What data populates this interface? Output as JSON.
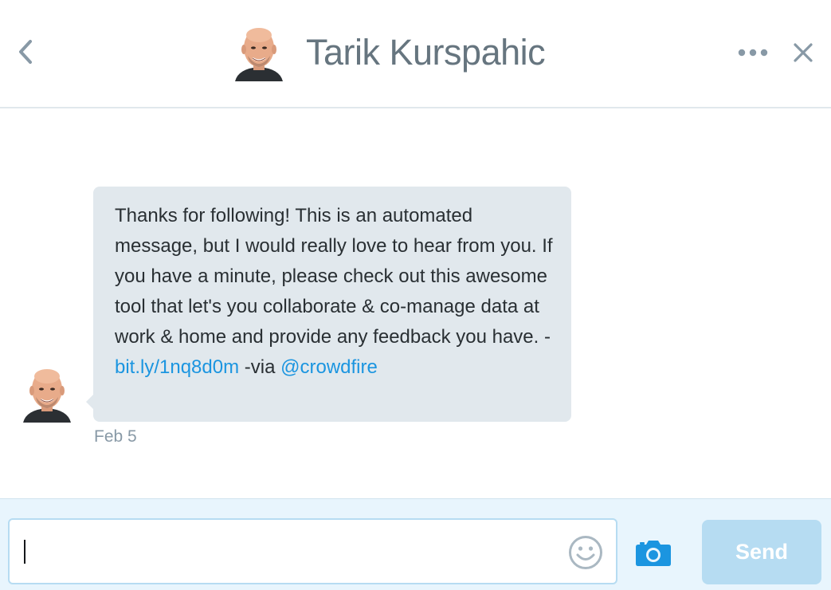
{
  "header": {
    "contact_name": "Tarik Kurspahic",
    "back_icon": "chevron-left-icon",
    "more_icon": "more-dots-icon",
    "close_icon": "close-icon"
  },
  "conversation": {
    "messages": [
      {
        "text_before_link": "Thanks for following! This is an automated message, but I would really love to hear from you. If you have a minute, please check out this awesome tool that let's you collaborate & co-manage data at work & home and provide any feedback you have. - ",
        "link_text": "bit.ly/1nq8d0m",
        "text_after_link": " -via ",
        "mention_text": "@crowdfire",
        "timestamp": "Feb 5"
      }
    ]
  },
  "composer": {
    "input_value": "",
    "input_placeholder": "",
    "emoji_icon": "smiley-icon",
    "camera_icon": "camera-icon",
    "send_label": "Send"
  },
  "colors": {
    "bubble_bg": "#e1e8ed",
    "link": "#1b95e0",
    "send_disabled": "#b6dcf2",
    "composer_bg": "#e8f5fd",
    "header_text": "#66757f"
  }
}
